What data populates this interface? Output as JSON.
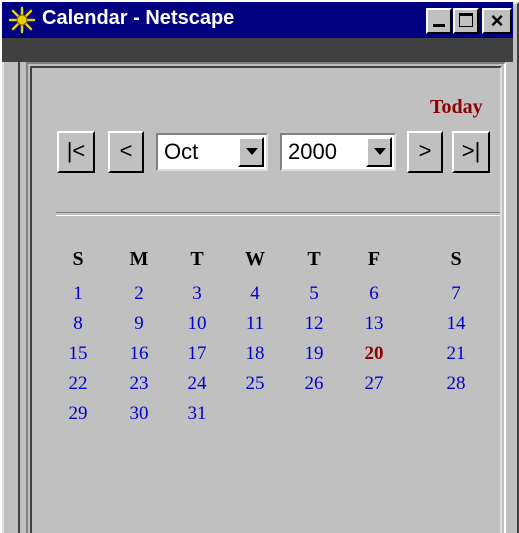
{
  "window": {
    "title": "Calendar - Netscape",
    "close_glyph": "×"
  },
  "calendar": {
    "today_link": "Today",
    "nav": {
      "first": "|<",
      "prev": "<",
      "next": ">",
      "last": ">|"
    },
    "month_selected": "Oct",
    "year_selected": "2000",
    "weekday_headers": [
      "S",
      "M",
      "T",
      "W",
      "T",
      "F",
      "S"
    ],
    "weeks": [
      [
        "1",
        "2",
        "3",
        "4",
        "5",
        "6",
        "7"
      ],
      [
        "8",
        "9",
        "10",
        "11",
        "12",
        "13",
        "14"
      ],
      [
        "15",
        "16",
        "17",
        "18",
        "19",
        "20",
        "21"
      ],
      [
        "22",
        "23",
        "24",
        "25",
        "26",
        "27",
        "28"
      ],
      [
        "29",
        "30",
        "31",
        "",
        "",
        "",
        ""
      ]
    ],
    "highlighted_day": "20",
    "colors": {
      "day_link": "#0000cc",
      "today": "#8b0000",
      "title_bar": "#000080",
      "background": "#c0c0c0"
    }
  }
}
